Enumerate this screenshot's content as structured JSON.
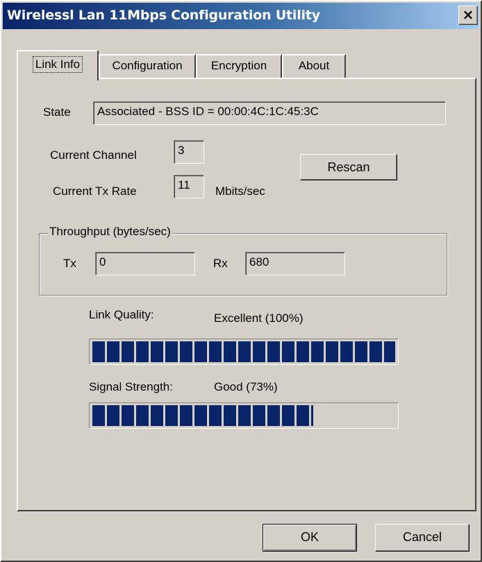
{
  "window": {
    "title": "Wirelessl Lan 11Mbps Configuration Utility",
    "close_glyph": "×"
  },
  "tabs": [
    {
      "label": "Link Info",
      "active": true
    },
    {
      "label": "Configuration",
      "active": false
    },
    {
      "label": "Encryption",
      "active": false
    },
    {
      "label": "About",
      "active": false
    }
  ],
  "link_info": {
    "state_label": "State",
    "state_value": "Associated - BSS ID =   00:00:4C:1C:45:3C",
    "channel_label": "Current Channel",
    "channel_value": "3",
    "tx_rate_label": "Current Tx Rate",
    "tx_rate_value": "11",
    "tx_rate_unit": "Mbits/sec",
    "rescan_label": "Rescan",
    "throughput": {
      "legend": "Throughput (bytes/sec)",
      "tx_label": "Tx",
      "tx_value": "0",
      "rx_label": "Rx",
      "rx_value": "680"
    },
    "link_quality": {
      "label": "Link Quality:",
      "value_text": "Excellent (100%)",
      "percent": 100
    },
    "signal_strength": {
      "label": "Signal Strength:",
      "value_text": "Good (73%)",
      "percent": 73
    }
  },
  "buttons": {
    "ok_label": "OK",
    "cancel_label": "Cancel"
  },
  "colors": {
    "face": "#d4d0c8",
    "title_start": "#0a246a",
    "title_end": "#a6caf0",
    "progress_block": "#0a246a"
  }
}
